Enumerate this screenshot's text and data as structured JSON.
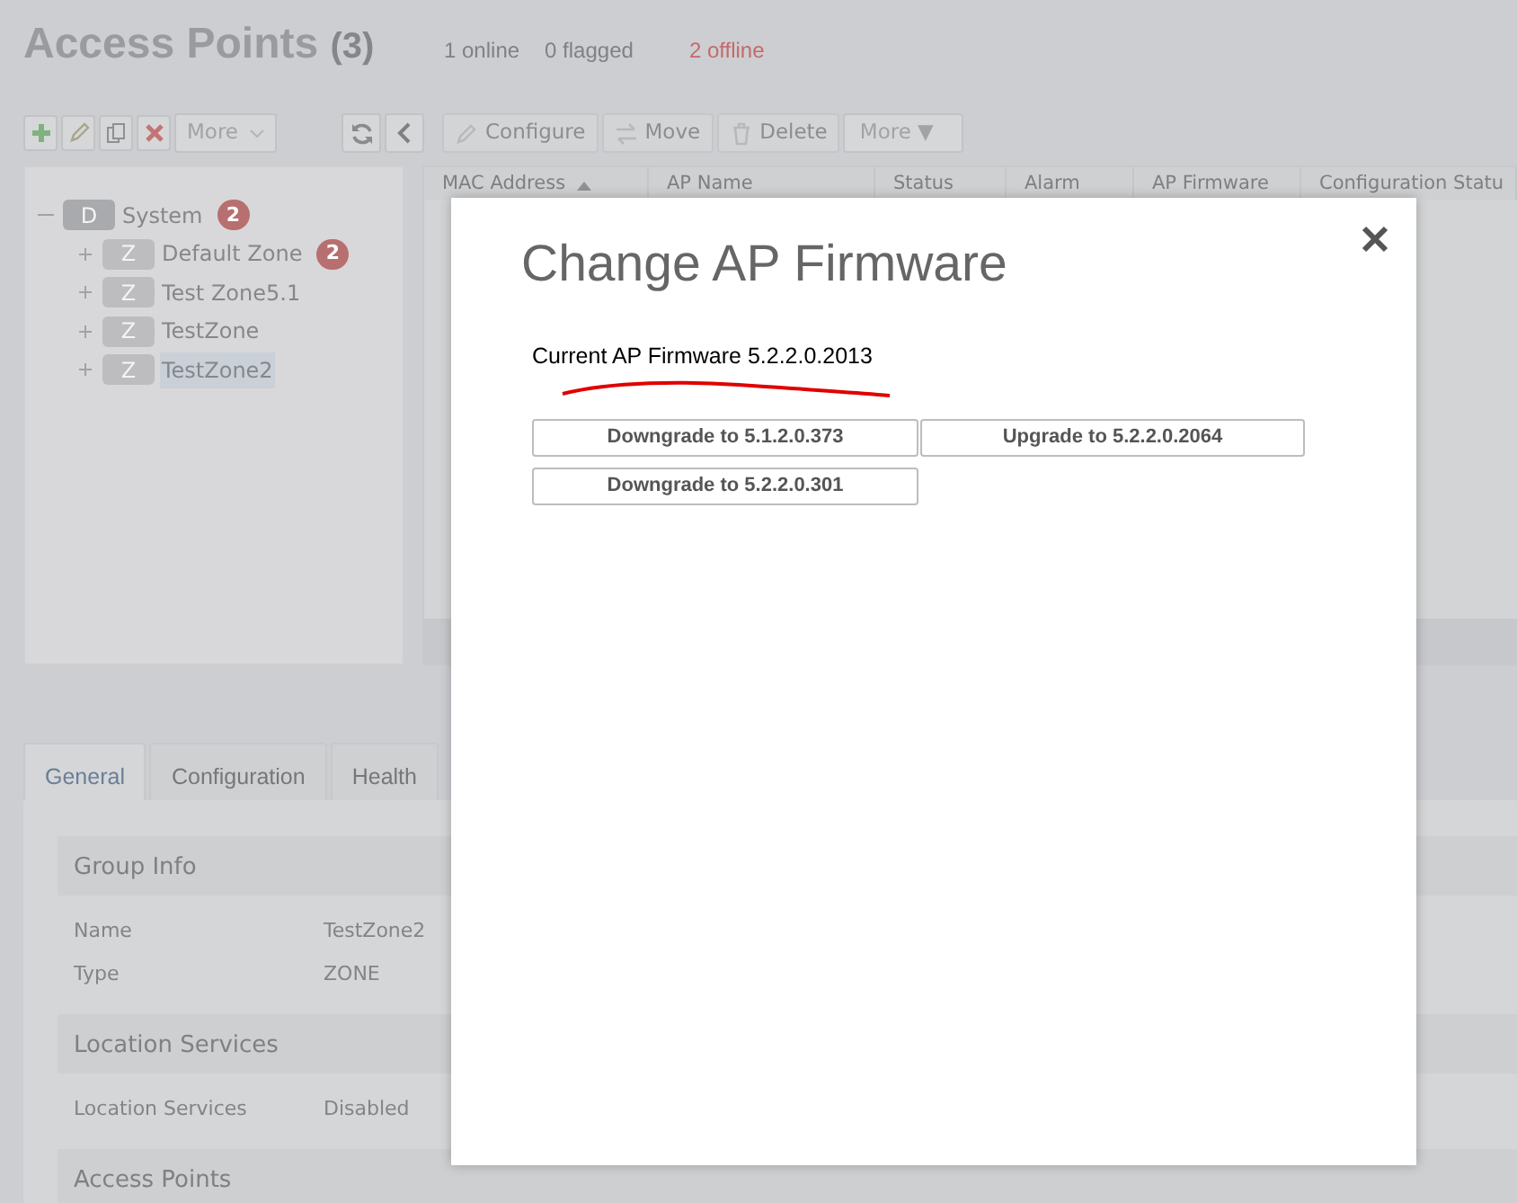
{
  "page": {
    "title": "Access Points",
    "count": "(3)",
    "stats": [
      {
        "label": "1 online",
        "kind": "normal"
      },
      {
        "label": "0 flagged",
        "kind": "normal"
      },
      {
        "label": "2 offline",
        "kind": "alert"
      }
    ]
  },
  "tree_toolbar": {
    "more": "More"
  },
  "table_toolbar": {
    "buttons": [
      {
        "label": "Configure",
        "kind": "pencil"
      },
      {
        "label": "Move",
        "kind": "move"
      },
      {
        "label": "Delete",
        "kind": "trash"
      }
    ],
    "more": "More ▼"
  },
  "tree": [
    {
      "letter": "D",
      "label": "System",
      "count": "2",
      "expanded": true,
      "selected": false,
      "children": [
        {
          "letter": "Z",
          "label": "Default Zone",
          "count": "2",
          "expanded": false,
          "selected": false
        },
        {
          "letter": "Z",
          "label": "Test Zone5.1",
          "expanded": false,
          "selected": false
        },
        {
          "letter": "Z",
          "label": "TestZone",
          "expanded": false,
          "selected": false
        },
        {
          "letter": "Z",
          "label": "TestZone2",
          "expanded": false,
          "selected": true
        }
      ]
    }
  ],
  "table": {
    "columns": [
      {
        "label": "MAC Address",
        "sorted": true
      },
      {
        "label": "AP Name",
        "sorted": false
      },
      {
        "label": "Status",
        "sorted": false
      },
      {
        "label": "Alarm",
        "sorted": false
      },
      {
        "label": "AP Firmware",
        "sorted": false
      },
      {
        "label": "Configuration Statu",
        "sorted": false
      }
    ]
  },
  "tabs": [
    {
      "label": "General",
      "selected": true
    },
    {
      "label": "Configuration",
      "selected": false
    },
    {
      "label": "Health",
      "selected": false
    }
  ],
  "sections": [
    {
      "title": "Group Info",
      "fields": [
        {
          "label": "Name",
          "value": "TestZone2"
        },
        {
          "label": "Type",
          "value": "ZONE"
        }
      ]
    },
    {
      "title": "Location Services",
      "fields": [
        {
          "label": "Location Services",
          "value": "Disabled"
        }
      ]
    },
    {
      "title": "Access Points"
    }
  ],
  "dialog": {
    "title": "Change AP Firmware",
    "current": "Current AP Firmware 5.2.2.0.2013",
    "options": [
      "Downgrade to 5.1.2.0.373",
      "Upgrade to 5.2.2.0.2064",
      "Downgrade to 5.2.2.0.301"
    ]
  }
}
